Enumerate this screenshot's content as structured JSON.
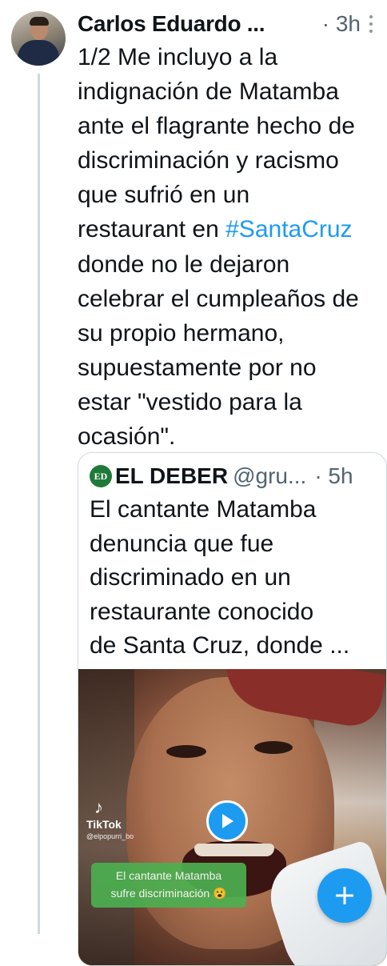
{
  "tweet": {
    "author": {
      "name": "Carlos Eduardo ..."
    },
    "time": "· 3h",
    "text_lines": [
      "1/2 Me incluyo a la",
      "indignación de Matamba",
      "ante el flagrante hecho de",
      "discriminación y racismo",
      "que sufrió en un",
      "restaurant en ",
      "donde no le dejaron",
      "celebrar el cumpleaños de",
      "su propio hermano,",
      "supuestamente por no",
      "estar \"vestido para la",
      "ocasión\"."
    ],
    "hashtag": "#SantaCruz"
  },
  "quote": {
    "author": "EL DEBER",
    "handle": "@gru...",
    "time": "· 5h",
    "logo_text": "ED",
    "text_lines": [
      "El cantante Matamba",
      "denuncia que fue",
      "discriminado en un",
      "restaurante conocido",
      "de Santa Cruz, donde ..."
    ],
    "video": {
      "tiktok_name": "TikTok",
      "tiktok_user": "@elpopurri_bo",
      "caption_line1": "El cantante Matamba",
      "caption_line2": "sufre discriminación 😮"
    }
  },
  "colors": {
    "accent": "#1d9bf0",
    "text_primary": "#0f1419",
    "text_secondary": "#536471",
    "border": "#cfd9de",
    "caption_bg": "#4caf50"
  },
  "icons": {
    "more": "more-vertical-icon",
    "play": "play-icon",
    "compose": "plus-icon",
    "tiktok": "tiktok-logo-icon"
  }
}
